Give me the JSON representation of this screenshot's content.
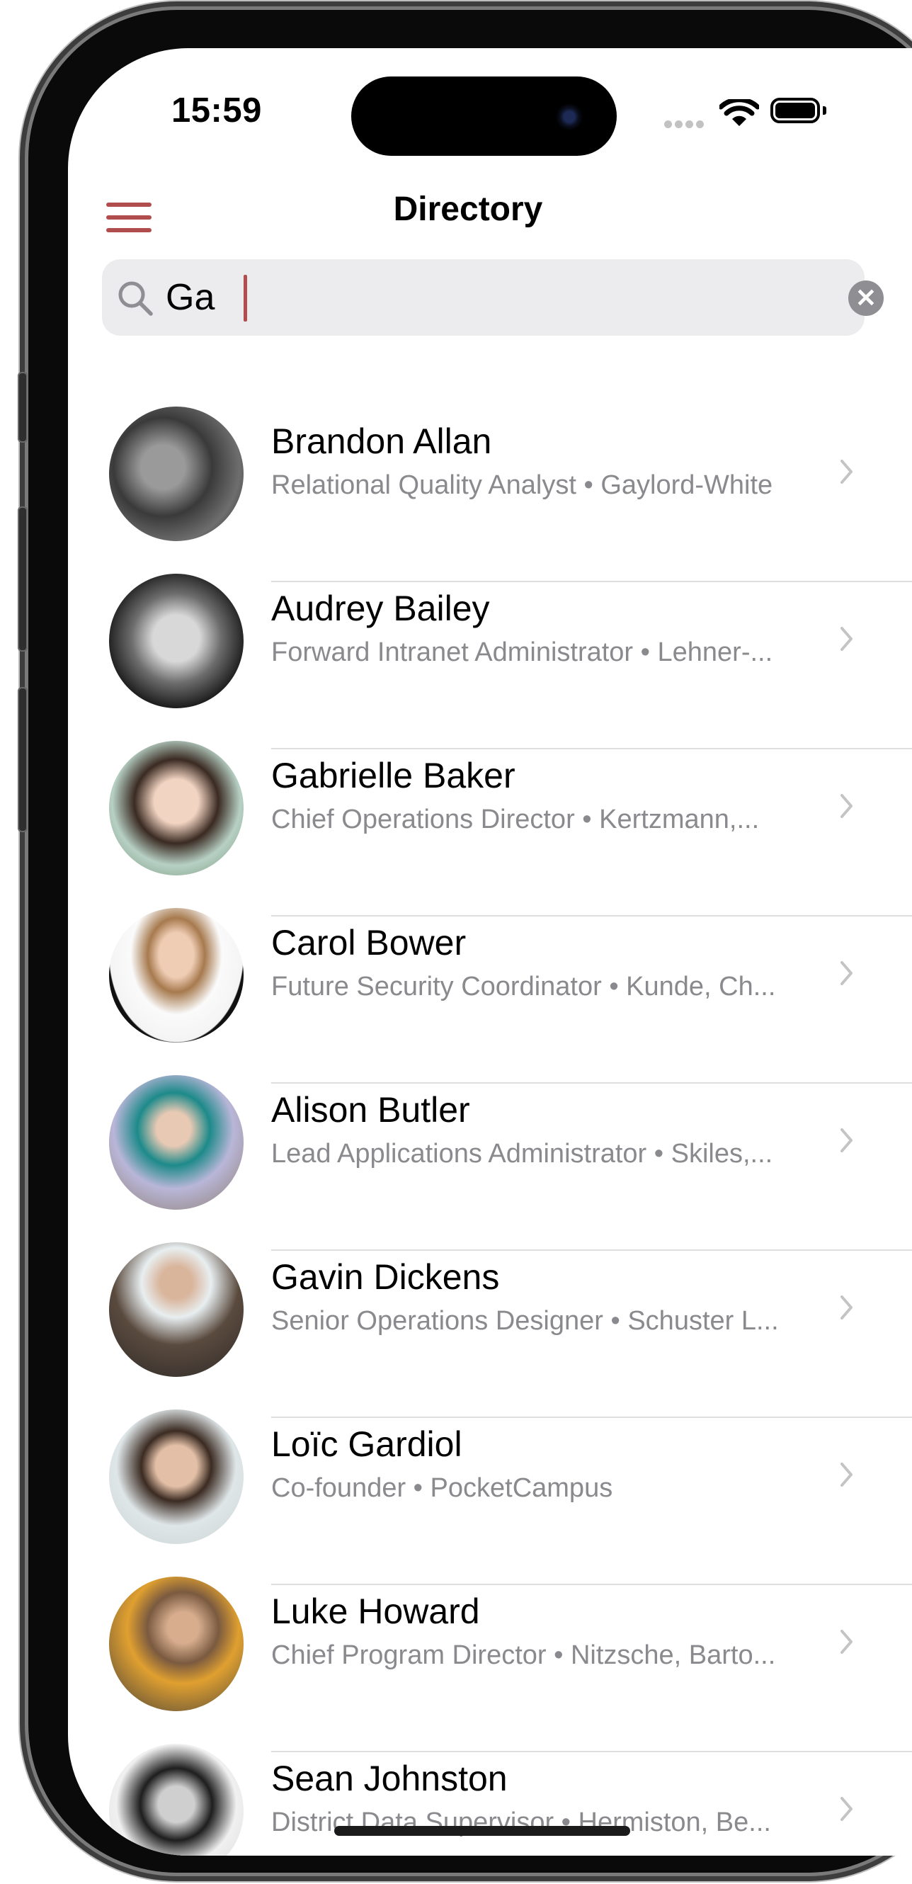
{
  "status": {
    "time": "15:59"
  },
  "nav": {
    "title": "Directory"
  },
  "search": {
    "value": "Ga",
    "placeholder": "Search"
  },
  "colors": {
    "accent": "#b24d4d",
    "secondary_text": "#8a8a8e",
    "search_bg": "#ececee"
  },
  "contacts": [
    {
      "name": "Brandon Allan",
      "subtitle": "Relational Quality Analyst • Gaylord-White"
    },
    {
      "name": "Audrey Bailey",
      "subtitle": "Forward Intranet Administrator • Lehner-..."
    },
    {
      "name": "Gabrielle Baker",
      "subtitle": "Chief Operations Director • Kertzmann,..."
    },
    {
      "name": "Carol Bower",
      "subtitle": "Future Security Coordinator • Kunde, Ch..."
    },
    {
      "name": "Alison Butler",
      "subtitle": "Lead Applications Administrator • Skiles,..."
    },
    {
      "name": "Gavin Dickens",
      "subtitle": "Senior Operations Designer • Schuster L..."
    },
    {
      "name": "Loïc Gardiol",
      "subtitle": "Co-founder • PocketCampus"
    },
    {
      "name": "Luke Howard",
      "subtitle": "Chief Program Director • Nitzsche, Barto..."
    },
    {
      "name": "Sean Johnston",
      "subtitle": "District Data Supervisor • Hermiston, Be..."
    }
  ]
}
